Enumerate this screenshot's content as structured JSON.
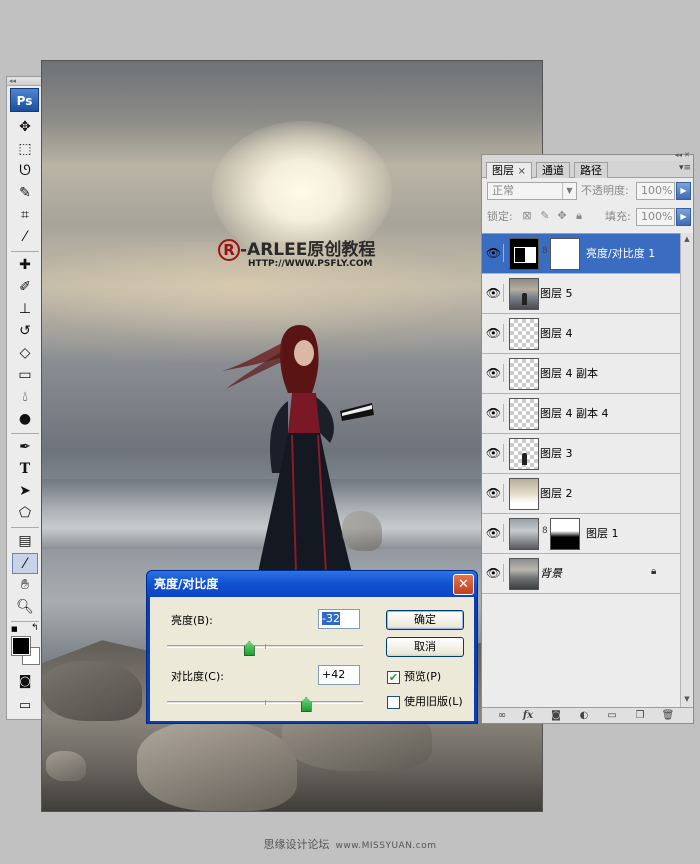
{
  "toolbox": {
    "badge": "Ps",
    "tools": [
      "move-tool",
      "marquee-tool",
      "lasso-tool",
      "quick-select-tool",
      "crop-tool",
      "eyedropper-tool",
      "healing-brush-tool",
      "brush-tool",
      "clone-stamp-tool",
      "history-brush-tool",
      "eraser-tool",
      "gradient-tool",
      "blur-tool",
      "dodge-tool",
      "pen-tool",
      "type-tool",
      "path-select-tool",
      "shape-tool",
      "notes-tool",
      "eyedropper-tool-2",
      "hand-tool",
      "zoom-tool"
    ],
    "type_glyph": "T",
    "foreground_color": "#000000",
    "background_color": "#ffffff"
  },
  "canvas": {
    "watermark_title": "-ARLEE原创教程",
    "watermark_symbol": "R",
    "watermark_url": "HTTP://WWW.PSFLY.COM"
  },
  "layers_panel": {
    "tabs": [
      {
        "label": "图层",
        "active": true,
        "close": "×"
      },
      {
        "label": "通道",
        "active": false
      },
      {
        "label": "路径",
        "active": false
      }
    ],
    "blend_mode": "正常",
    "opacity_label": "不透明度:",
    "opacity_value": "100%",
    "lock_label": "锁定:",
    "fill_label": "填充:",
    "fill_value": "100%",
    "layers": [
      {
        "name": "亮度/对比度 1",
        "selected": true
      },
      {
        "name": "图层 5",
        "selected": false
      },
      {
        "name": "图层 4",
        "selected": false
      },
      {
        "name": "图层 4 副本",
        "selected": false
      },
      {
        "name": "图层 4 副本 4",
        "selected": false
      },
      {
        "name": "图层 3",
        "selected": false
      },
      {
        "name": "图层 2",
        "selected": false
      },
      {
        "name": "图层 1",
        "selected": false
      },
      {
        "name": "背景",
        "selected": false
      }
    ],
    "bottom_icons": [
      "link-icon",
      "fx-icon",
      "mask-icon",
      "adjustment-icon",
      "group-icon",
      "new-layer-icon",
      "trash-icon"
    ],
    "fx_label": "fx"
  },
  "dialog": {
    "title": "亮度/对比度",
    "close": "✕",
    "brightness_label": "亮度(B):",
    "brightness_value": "-32",
    "brightness_fraction": 0.42,
    "contrast_label": "对比度(C):",
    "contrast_value": "+42",
    "contrast_fraction": 0.71,
    "ok_label": "确定",
    "cancel_label": "取消",
    "preview_label": "预览(P)",
    "preview_checked": true,
    "legacy_label": "使用旧版(L)",
    "legacy_checked": false
  },
  "footer": {
    "text": "思缘设计论坛",
    "url": "www.MISSYUAN.com"
  }
}
